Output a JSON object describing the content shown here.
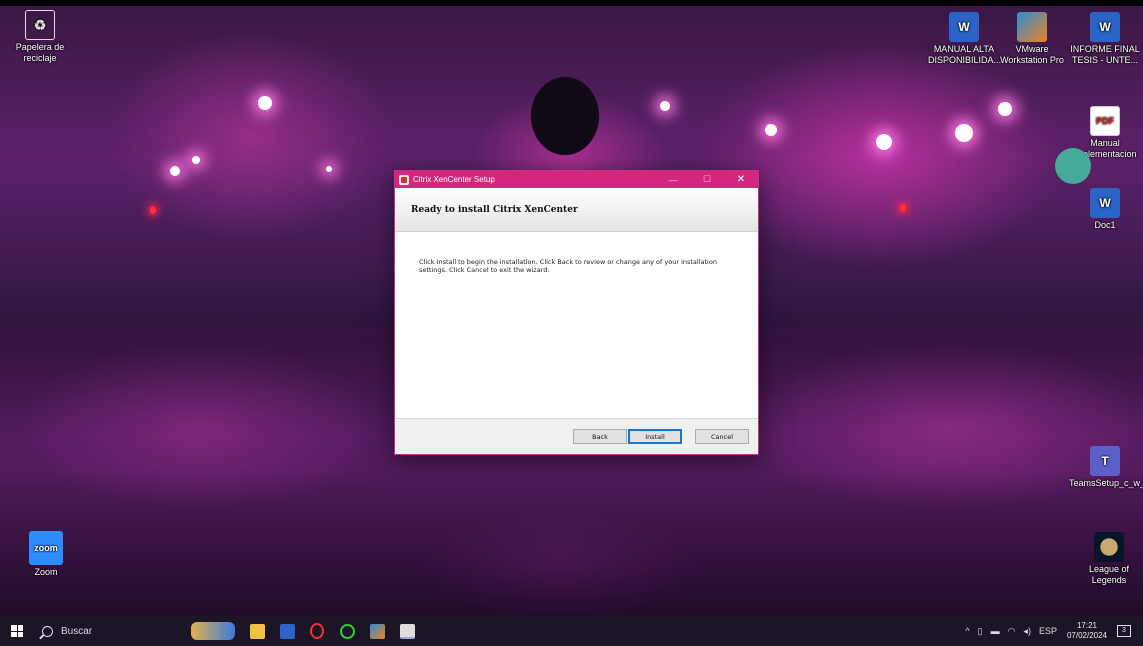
{
  "desktop": {
    "icons": [
      {
        "name": "recycle-bin",
        "label": "Papelera de reciclaje",
        "icon": "recycle-bin-icon"
      },
      {
        "name": "manual-alta",
        "label": "MANUAL ALTA DISPONIBILIDA...",
        "icon": "word-doc-icon"
      },
      {
        "name": "vmware",
        "label": "VMware Workstation Pro",
        "icon": "vmware-icon"
      },
      {
        "name": "informe-final",
        "label": "INFORME FINAL TESIS - UNTE...",
        "icon": "word-doc-icon"
      },
      {
        "name": "manual-implementacion",
        "label": "Manual implementacion",
        "icon": "pdf-icon"
      },
      {
        "name": "doc1",
        "label": "Doc1",
        "icon": "word-doc-icon"
      },
      {
        "name": "teams-setup",
        "label": "TeamsSetup_c_w_",
        "icon": "teams-icon"
      },
      {
        "name": "zoom",
        "label": "Zoom",
        "icon": "zoom-icon"
      },
      {
        "name": "league",
        "label": "League of Legends",
        "icon": "league-icon"
      }
    ],
    "glyphs": {
      "word": "W",
      "pdf": "PDF",
      "zoom": "zoom",
      "teams": "T"
    }
  },
  "window": {
    "title": "Citrix XenCenter Setup",
    "heading": "Ready to install Citrix XenCenter",
    "body": "Click Install to begin the installation. Click Back to review or change any of your installation settings. Click Cancel to exit the wizard.",
    "minimize": "—",
    "maximize": "☐",
    "close": "✕",
    "buttons": {
      "back": "Back",
      "install": "Install",
      "cancel": "Cancel"
    },
    "accent": "#d4267e"
  },
  "taskbar": {
    "search_placeholder": "Buscar",
    "language": "ESP",
    "time": "17:21",
    "date": "07/02/2024",
    "notifications": "3",
    "tray_up": "^"
  }
}
